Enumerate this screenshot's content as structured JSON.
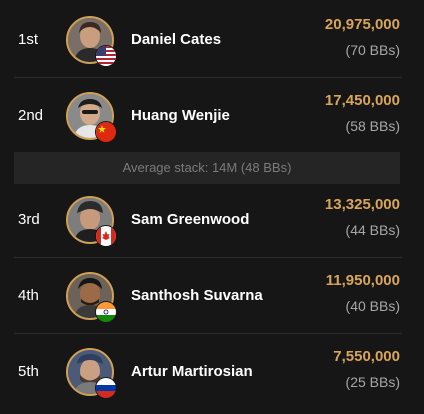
{
  "players": [
    {
      "rank": "1st",
      "name": "Daniel Cates",
      "chips": "20,975,000",
      "bbs": "(70 BBs)",
      "flag": "us-flag-icon"
    },
    {
      "rank": "2nd",
      "name": "Huang Wenjie",
      "chips": "17,450,000",
      "bbs": "(58 BBs)",
      "flag": "china-flag-icon"
    },
    {
      "rank": "3rd",
      "name": "Sam Greenwood",
      "chips": "13,325,000",
      "bbs": "(44 BBs)",
      "flag": "canada-flag-icon"
    },
    {
      "rank": "4th",
      "name": "Santhosh Suvarna",
      "chips": "11,950,000",
      "bbs": "(40 BBs)",
      "flag": "india-flag-icon"
    },
    {
      "rank": "5th",
      "name": "Artur Martirosian",
      "chips": "7,550,000",
      "bbs": "(25 BBs)",
      "flag": "russia-flag-icon"
    }
  ],
  "average_stack": "Average stack: 14M (48 BBs)",
  "colors": {
    "accent_gold": "#d9a55a",
    "background": "#161616",
    "muted": "#a7a7a7"
  }
}
